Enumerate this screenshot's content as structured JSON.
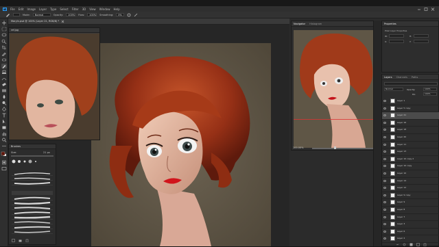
{
  "app": {
    "menu": [
      "File",
      "Edit",
      "Image",
      "Layer",
      "Type",
      "Select",
      "Filter",
      "3D",
      "View",
      "Window",
      "Help"
    ],
    "options": {
      "mode_label": "Mode:",
      "mode_value": "Normal",
      "opacity_label": "Opacity:",
      "opacity_value": "100%",
      "flow_label": "Flow:",
      "flow_value": "100%",
      "smoothing_label": "Smoothing:",
      "smoothing_value": "0%"
    }
  },
  "document": {
    "tab_title": "Maryln.psd @ 100% (Layer 21, RGB/8) *",
    "ref_title": "ref.jpg"
  },
  "brushes_panel": {
    "title": "Brushes",
    "size_label": "Size:",
    "size_value": "21 px"
  },
  "navigator": {
    "tab1": "Navigator",
    "tab2": "Histogram",
    "zoom": "100.00%"
  },
  "properties": {
    "title": "Properties",
    "subtitle": "Pixel Layer Properties",
    "w_label": "W:",
    "h_label": "H:",
    "x_label": "X:",
    "y_label": "Y:"
  },
  "layers_panel": {
    "tabs": [
      "Layers",
      "Channels",
      "Paths"
    ],
    "blend": "Normal",
    "opacity_label": "Opacity:",
    "opacity": "100%",
    "fill_label": "Fill:",
    "fill": "100%",
    "items": [
      {
        "name": "Layer 1"
      },
      {
        "name": "Layer 5 copy"
      },
      {
        "name": "Layer 21",
        "selected": true
      },
      {
        "name": "Layer 16"
      },
      {
        "name": "Layer 18"
      },
      {
        "name": "Layer 20"
      },
      {
        "name": "Layer 11"
      },
      {
        "name": "Layer 13"
      },
      {
        "name": "Layer 10 copy 2"
      },
      {
        "name": "Layer 10 copy"
      },
      {
        "name": "Layer 10"
      },
      {
        "name": "Layer 14"
      },
      {
        "name": "Layer 12"
      },
      {
        "name": "Layer 9 copy"
      },
      {
        "name": "Layer 9"
      },
      {
        "name": "Layer 8"
      },
      {
        "name": "Layer 7"
      },
      {
        "name": "Layer 3"
      },
      {
        "name": "Layer 6"
      },
      {
        "name": "Layer 2"
      }
    ]
  },
  "colors": {
    "accent": "#2fa3ff",
    "hair": "#a6381b",
    "skin": "#e5b8a3",
    "lips": "#d1141c"
  }
}
